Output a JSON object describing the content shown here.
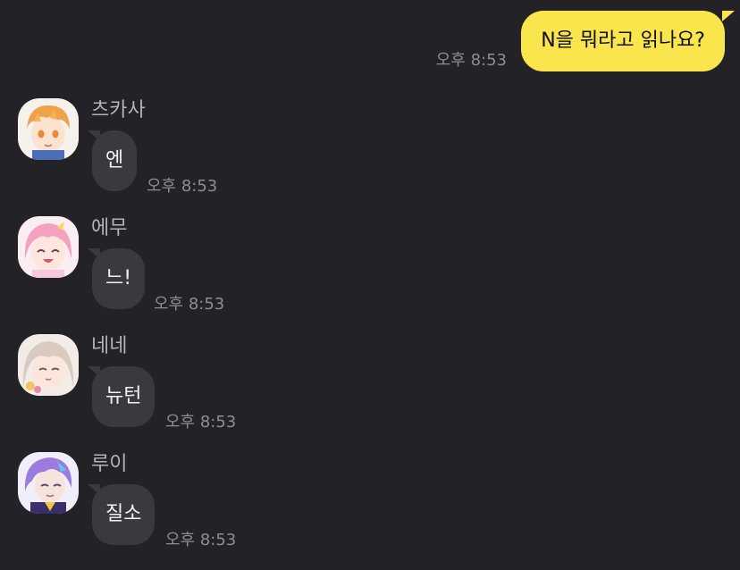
{
  "my_message": {
    "text": "N을 뭐라고 읽나요?",
    "time": "오후 8:53"
  },
  "messages": [
    {
      "sender": "츠카사",
      "text": "엔",
      "time": "오후 8:53",
      "avatar_icon": "avatar-orange-hair-boy"
    },
    {
      "sender": "에무",
      "text": "느!",
      "time": "오후 8:53",
      "avatar_icon": "avatar-pink-hair-girl"
    },
    {
      "sender": "네네",
      "text": "뉴턴",
      "time": "오후 8:53",
      "avatar_icon": "avatar-beige-hair-girl"
    },
    {
      "sender": "루이",
      "text": "질소",
      "time": "오후 8:53",
      "avatar_icon": "avatar-purple-hair-boy"
    }
  ],
  "colors": {
    "background": "#232226",
    "my_bubble": "#fbe54d",
    "other_bubble": "#3a393d",
    "timestamp": "#8e8d92",
    "sender_name": "#b4b3b8"
  }
}
